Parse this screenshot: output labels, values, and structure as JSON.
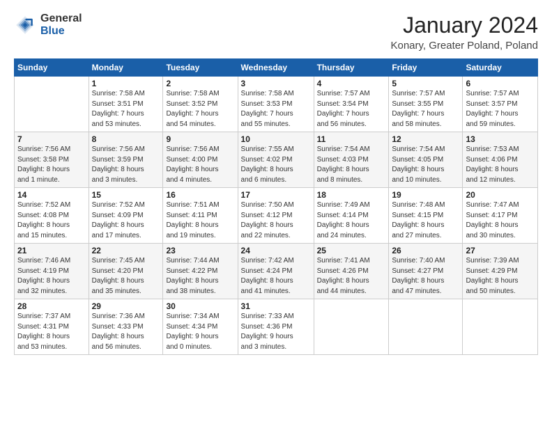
{
  "header": {
    "logo_general": "General",
    "logo_blue": "Blue",
    "title": "January 2024",
    "subtitle": "Konary, Greater Poland, Poland"
  },
  "calendar": {
    "days_of_week": [
      "Sunday",
      "Monday",
      "Tuesday",
      "Wednesday",
      "Thursday",
      "Friday",
      "Saturday"
    ],
    "weeks": [
      [
        {
          "day": "",
          "info": ""
        },
        {
          "day": "1",
          "info": "Sunrise: 7:58 AM\nSunset: 3:51 PM\nDaylight: 7 hours\nand 53 minutes."
        },
        {
          "day": "2",
          "info": "Sunrise: 7:58 AM\nSunset: 3:52 PM\nDaylight: 7 hours\nand 54 minutes."
        },
        {
          "day": "3",
          "info": "Sunrise: 7:58 AM\nSunset: 3:53 PM\nDaylight: 7 hours\nand 55 minutes."
        },
        {
          "day": "4",
          "info": "Sunrise: 7:57 AM\nSunset: 3:54 PM\nDaylight: 7 hours\nand 56 minutes."
        },
        {
          "day": "5",
          "info": "Sunrise: 7:57 AM\nSunset: 3:55 PM\nDaylight: 7 hours\nand 58 minutes."
        },
        {
          "day": "6",
          "info": "Sunrise: 7:57 AM\nSunset: 3:57 PM\nDaylight: 7 hours\nand 59 minutes."
        }
      ],
      [
        {
          "day": "7",
          "info": "Sunrise: 7:56 AM\nSunset: 3:58 PM\nDaylight: 8 hours\nand 1 minute."
        },
        {
          "day": "8",
          "info": "Sunrise: 7:56 AM\nSunset: 3:59 PM\nDaylight: 8 hours\nand 3 minutes."
        },
        {
          "day": "9",
          "info": "Sunrise: 7:56 AM\nSunset: 4:00 PM\nDaylight: 8 hours\nand 4 minutes."
        },
        {
          "day": "10",
          "info": "Sunrise: 7:55 AM\nSunset: 4:02 PM\nDaylight: 8 hours\nand 6 minutes."
        },
        {
          "day": "11",
          "info": "Sunrise: 7:54 AM\nSunset: 4:03 PM\nDaylight: 8 hours\nand 8 minutes."
        },
        {
          "day": "12",
          "info": "Sunrise: 7:54 AM\nSunset: 4:05 PM\nDaylight: 8 hours\nand 10 minutes."
        },
        {
          "day": "13",
          "info": "Sunrise: 7:53 AM\nSunset: 4:06 PM\nDaylight: 8 hours\nand 12 minutes."
        }
      ],
      [
        {
          "day": "14",
          "info": "Sunrise: 7:52 AM\nSunset: 4:08 PM\nDaylight: 8 hours\nand 15 minutes."
        },
        {
          "day": "15",
          "info": "Sunrise: 7:52 AM\nSunset: 4:09 PM\nDaylight: 8 hours\nand 17 minutes."
        },
        {
          "day": "16",
          "info": "Sunrise: 7:51 AM\nSunset: 4:11 PM\nDaylight: 8 hours\nand 19 minutes."
        },
        {
          "day": "17",
          "info": "Sunrise: 7:50 AM\nSunset: 4:12 PM\nDaylight: 8 hours\nand 22 minutes."
        },
        {
          "day": "18",
          "info": "Sunrise: 7:49 AM\nSunset: 4:14 PM\nDaylight: 8 hours\nand 24 minutes."
        },
        {
          "day": "19",
          "info": "Sunrise: 7:48 AM\nSunset: 4:15 PM\nDaylight: 8 hours\nand 27 minutes."
        },
        {
          "day": "20",
          "info": "Sunrise: 7:47 AM\nSunset: 4:17 PM\nDaylight: 8 hours\nand 30 minutes."
        }
      ],
      [
        {
          "day": "21",
          "info": "Sunrise: 7:46 AM\nSunset: 4:19 PM\nDaylight: 8 hours\nand 32 minutes."
        },
        {
          "day": "22",
          "info": "Sunrise: 7:45 AM\nSunset: 4:20 PM\nDaylight: 8 hours\nand 35 minutes."
        },
        {
          "day": "23",
          "info": "Sunrise: 7:44 AM\nSunset: 4:22 PM\nDaylight: 8 hours\nand 38 minutes."
        },
        {
          "day": "24",
          "info": "Sunrise: 7:42 AM\nSunset: 4:24 PM\nDaylight: 8 hours\nand 41 minutes."
        },
        {
          "day": "25",
          "info": "Sunrise: 7:41 AM\nSunset: 4:26 PM\nDaylight: 8 hours\nand 44 minutes."
        },
        {
          "day": "26",
          "info": "Sunrise: 7:40 AM\nSunset: 4:27 PM\nDaylight: 8 hours\nand 47 minutes."
        },
        {
          "day": "27",
          "info": "Sunrise: 7:39 AM\nSunset: 4:29 PM\nDaylight: 8 hours\nand 50 minutes."
        }
      ],
      [
        {
          "day": "28",
          "info": "Sunrise: 7:37 AM\nSunset: 4:31 PM\nDaylight: 8 hours\nand 53 minutes."
        },
        {
          "day": "29",
          "info": "Sunrise: 7:36 AM\nSunset: 4:33 PM\nDaylight: 8 hours\nand 56 minutes."
        },
        {
          "day": "30",
          "info": "Sunrise: 7:34 AM\nSunset: 4:34 PM\nDaylight: 9 hours\nand 0 minutes."
        },
        {
          "day": "31",
          "info": "Sunrise: 7:33 AM\nSunset: 4:36 PM\nDaylight: 9 hours\nand 3 minutes."
        },
        {
          "day": "",
          "info": ""
        },
        {
          "day": "",
          "info": ""
        },
        {
          "day": "",
          "info": ""
        }
      ]
    ]
  }
}
